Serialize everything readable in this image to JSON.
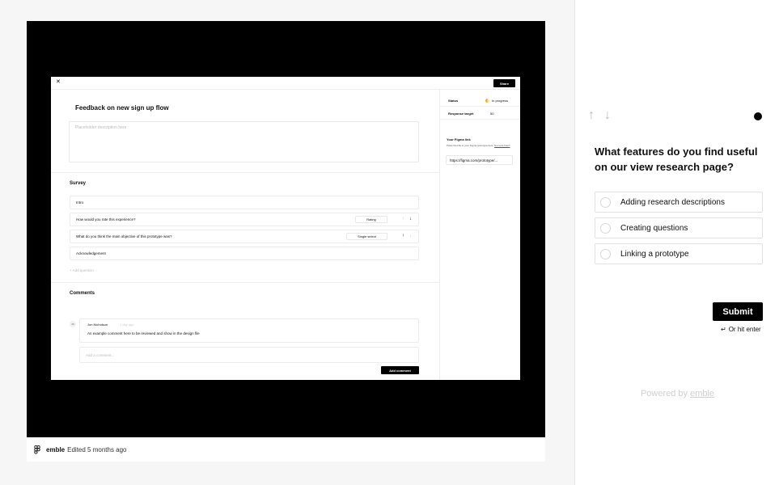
{
  "embed": {
    "prototype": {
      "close_icon": "close-icon",
      "share_label": "Share",
      "title": "Feedback on new sign up flow",
      "description_placeholder": "Placeholder description here",
      "survey_heading": "Survey",
      "questions": [
        {
          "text": "Intro",
          "type": ""
        },
        {
          "text": "How would you rate this experience?",
          "type": "Rating"
        },
        {
          "text": "What do you think the main objective of this prototype was?",
          "type": "Single select"
        },
        {
          "text": "Acknowledgement",
          "type": ""
        }
      ],
      "add_question_label": "+  Add question",
      "comments_heading": "Comments",
      "comment": {
        "avatar_initials": "JN",
        "author": "Jon Nicholson",
        "date": "1 day ago",
        "text": "An example comment here to be reviewed and show in the design file"
      },
      "comment_input_placeholder": "Add a comment...",
      "add_comment_label": "Add comment",
      "sidebar": {
        "status_label": "Status",
        "status_value": "In progress",
        "status_color": "#f5a623",
        "target_label": "Response target",
        "target_value": "50",
        "figma_link_title": "Your Figma link",
        "figma_link_hint": "Paste the link to your Figma prototype here.",
        "figma_link_hint_link": "Not sure how?",
        "figma_url": "https://figma.com/prototype/..."
      }
    },
    "footer": {
      "app_icon": "figma-logo-icon",
      "org": "emble",
      "edited": "Edited 5 months ago"
    }
  },
  "survey_panel": {
    "up_icon": "arrow-up-icon",
    "down_icon": "arrow-down-icon",
    "question": "What features do you find useful on our view research page?",
    "options": [
      "Adding research descriptions",
      "Creating questions",
      "Linking a prototype"
    ],
    "submit_label": "Submit",
    "enter_hint_symbol": "↵",
    "enter_hint_text": "Or hit enter",
    "powered_by": "Powered by",
    "brand": "emble"
  }
}
